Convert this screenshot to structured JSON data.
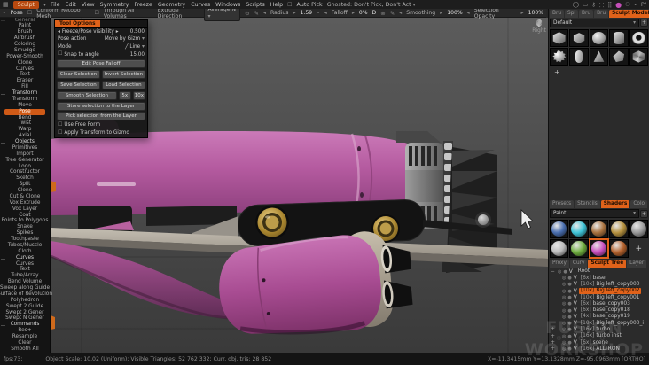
{
  "colors": {
    "accent": "#e0621a",
    "model_pink": "#b4599f",
    "gold": "#c9a84e",
    "selected_shader": "#c94fc0",
    "pose_highlight": "#cf5a17"
  },
  "icons": {
    "logo": "▦",
    "caret": "▾",
    "checkbox": "☐",
    "arrow_l": "◂",
    "arrow_r": "▸",
    "gizmo": "⌖",
    "lock": "⊝",
    "pen": "✎",
    "zoom": "⌕",
    "sphere": "⊚",
    "view_circle": "◉",
    "ghost": "◎",
    "volume": "●",
    "v": "V",
    "mode_slash": "╱",
    "plus": "+"
  },
  "menu": {
    "room": "Sculpt",
    "items": [
      "File",
      "Edit",
      "View",
      "Symmetry",
      "Freeze",
      "Geometry",
      "Curves",
      "Windows",
      "Scripts",
      "Help"
    ],
    "auto_pick": "Auto Pick",
    "ghosted_label": "Ghosted:",
    "ghosted_value": "Don't Pick, Don't Act"
  },
  "menu_icons": [
    {
      "glyph": "◯"
    },
    {
      "glyph": "▭"
    },
    {
      "glyph": "⚷"
    },
    {
      "glyph": "⸬"
    },
    {
      "glyph": "⣿"
    },
    {
      "glyph": "●",
      "magenta": true
    },
    {
      "glyph": "⚇"
    },
    {
      "glyph": "⌁"
    },
    {
      "glyph": "P/"
    }
  ],
  "toolbar": {
    "pose": "Pose",
    "conform": "Conform Retopo Mesh",
    "through": "Through All Volumes",
    "extrude": "Extrude Direction",
    "average": "Average N",
    "radius_label": "Radius",
    "radius_value": "1.59",
    "falloff_label": "Falloff",
    "falloff_value": "0%",
    "d_button": "D",
    "smoothing_label": "Smoothing",
    "smoothing_value": "100%",
    "opacity_label": "Selection Opacity",
    "opacity_value": "100%"
  },
  "sidebar": [
    {
      "label": "General",
      "header": true,
      "clipped": true
    },
    {
      "label": "Paint"
    },
    {
      "label": "Brush"
    },
    {
      "label": "Airbrush"
    },
    {
      "label": "Coloring"
    },
    {
      "label": "Smudge"
    },
    {
      "label": "Power-Smooth"
    },
    {
      "label": "Clone"
    },
    {
      "label": "Curves"
    },
    {
      "label": "Text"
    },
    {
      "label": "Eraser"
    },
    {
      "label": "Fill"
    },
    {
      "label": "Transform",
      "header": true
    },
    {
      "label": "Transform"
    },
    {
      "label": "Move"
    },
    {
      "label": "Pose",
      "selected": true
    },
    {
      "label": "Bend"
    },
    {
      "label": "Twist"
    },
    {
      "label": "Warp"
    },
    {
      "label": "Axial"
    },
    {
      "label": "Objects",
      "header": true
    },
    {
      "label": "Primitives"
    },
    {
      "label": "Import"
    },
    {
      "label": "Tree Generator"
    },
    {
      "label": "Logo"
    },
    {
      "label": "Constructor"
    },
    {
      "label": "Sketch"
    },
    {
      "label": "Split"
    },
    {
      "label": "Clone"
    },
    {
      "label": "Cut & Clone"
    },
    {
      "label": "Vox Extrude"
    },
    {
      "label": "Vox Layer"
    },
    {
      "label": "Coat"
    },
    {
      "label": "Points to Polygons"
    },
    {
      "label": "Snake"
    },
    {
      "label": "Spikes"
    },
    {
      "label": "Toothpaste"
    },
    {
      "label": "Tubes/Muscle"
    },
    {
      "label": "Cloth"
    },
    {
      "label": "Curves",
      "header": true
    },
    {
      "label": "Curves"
    },
    {
      "label": "Text"
    },
    {
      "label": "Tube/Array"
    },
    {
      "label": "Bend Volume"
    },
    {
      "label": "Sweep along Guide"
    },
    {
      "label": "Surface of Revolution"
    },
    {
      "label": "Polyhedron"
    },
    {
      "label": "Swept 2 Guide"
    },
    {
      "label": "Swept 2 Gener"
    },
    {
      "label": "Swept N Gener"
    },
    {
      "label": "Commands",
      "header": true
    },
    {
      "label": "Res+"
    },
    {
      "label": "Resample"
    },
    {
      "label": "Clear"
    },
    {
      "label": "Smooth All"
    }
  ],
  "tool_options": {
    "title": "Tool Options",
    "visibility_label": "Freeze/Pose visibility",
    "visibility_value": "0.500",
    "pose_action_label": "Pose action",
    "pose_action_value": "Move by Gizm",
    "mode_label": "Mode",
    "mode_value": "Line",
    "snap_label": "Snap to angle",
    "snap_value": "15.00",
    "btn_edit": "Edit Pose Falloff",
    "btn_clear": "Clear Selection",
    "btn_invert": "Invert Selection",
    "btn_save": "Save Selection",
    "btn_load": "Load Selection",
    "btn_smooth": "Smooth Selection",
    "btn_5x": "5x",
    "btn_10x": "10x",
    "btn_store": "Store selection to the Layer",
    "btn_pick": "Pick selection from the Layer",
    "chk_freeform": "Use Free Form",
    "chk_apply": "Apply Transform to Gizmo"
  },
  "viewport": {
    "view_label": "Right"
  },
  "right_panel": {
    "top_tabs": [
      {
        "label": "Bru"
      },
      {
        "label": "Spl"
      },
      {
        "label": "Bru"
      },
      {
        "label": "Bru"
      },
      {
        "label": "Sculpt Models",
        "active": true
      },
      {
        "label": "..."
      }
    ],
    "models_dropdown": "Default",
    "models_add": "+",
    "models": [
      {
        "shape": "cube"
      },
      {
        "shape": "cube2"
      },
      {
        "shape": "sphere"
      },
      {
        "shape": "cylinder"
      },
      {
        "shape": "torus"
      },
      {
        "shape": "gear"
      },
      {
        "shape": "capsule"
      },
      {
        "shape": "cone"
      },
      {
        "shape": "poly"
      },
      {
        "shape": "ico"
      }
    ],
    "shader_tabs": [
      {
        "label": "Presets"
      },
      {
        "label": "Stencils"
      },
      {
        "label": "Shaders",
        "active": true
      },
      {
        "label": "Colo"
      }
    ],
    "shaders_dropdown": "Paint",
    "shaders_add": "+",
    "shaders": [
      {
        "color": "#4a6fb0"
      },
      {
        "color": "#3fc4d8"
      },
      {
        "color": "#a97340"
      },
      {
        "color": "#b5913f"
      },
      {
        "color": "#9b9b9b"
      },
      {
        "color": "#bcbcbc"
      },
      {
        "color": "#6fae3f"
      },
      {
        "color": "#c94fc0",
        "selected": true
      },
      {
        "color": "#b4622d"
      }
    ],
    "tree_tabs": [
      {
        "label": "Proxy"
      },
      {
        "label": "Curv"
      },
      {
        "label": "Sculpt Tree",
        "active": true
      },
      {
        "label": "Layer"
      }
    ],
    "tree": [
      {
        "prefix": "−",
        "count": "",
        "label": "Root",
        "root": true
      },
      {
        "prefix": "",
        "count": "[6x]",
        "label": "base"
      },
      {
        "prefix": "",
        "count": "[10x]",
        "label": "Big left_copy000"
      },
      {
        "prefix": "",
        "count": "[10x]",
        "label": "Big left_copy002",
        "selected": true
      },
      {
        "prefix": "",
        "count": "[10x]",
        "label": "Big left_copy001"
      },
      {
        "prefix": "",
        "count": "[6x]",
        "label": "base_copy003"
      },
      {
        "prefix": "",
        "count": "[6x]",
        "label": "base_copy018"
      },
      {
        "prefix": "",
        "count": "[4x]",
        "label": "base_copy019"
      },
      {
        "prefix": "",
        "count": "[10x]",
        "label": "Big left_copy000_i"
      },
      {
        "prefix": "+",
        "count": "[16x]",
        "label": "turbo"
      },
      {
        "prefix": "+",
        "count": "[16x]",
        "label": "turbo inst"
      },
      {
        "prefix": "+",
        "count": "[6x]",
        "label": "scene"
      },
      {
        "prefix": "+",
        "count": "[16x]",
        "label": "ALLTRON"
      }
    ]
  },
  "status": {
    "fps": "fps:73;",
    "info": "Object Scale: 10.02 (Uniform); Visible Triangles: 52 762 332; Curr. obj. tris: 28 852",
    "coords": "X=-11.3415mm  Y=13.1328mm  Z=-95.0963mm  [ORTHO]"
  },
  "watermark": {
    "line1": "FUSION",
    "line2": "WORKSHOP",
    "gears": "⚙ ⚙ ⚙"
  }
}
